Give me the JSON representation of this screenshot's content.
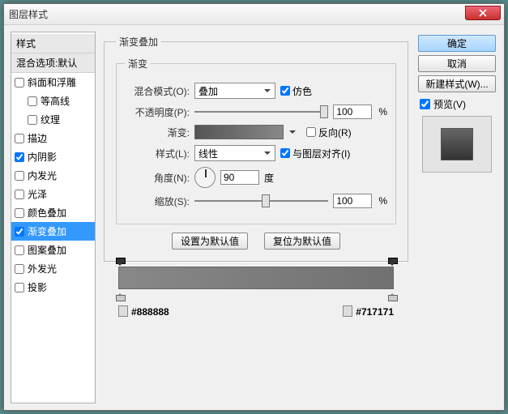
{
  "title": "图层样式",
  "sidebar": {
    "header": "样式",
    "blend_defaults": "混合选项:默认",
    "items": [
      {
        "label": "斜面和浮雕",
        "checked": false
      },
      {
        "label": "等高线",
        "checked": false,
        "sub": true
      },
      {
        "label": "纹理",
        "checked": false,
        "sub": true
      },
      {
        "label": "描边",
        "checked": false
      },
      {
        "label": "内阴影",
        "checked": true
      },
      {
        "label": "内发光",
        "checked": false
      },
      {
        "label": "光泽",
        "checked": false
      },
      {
        "label": "颜色叠加",
        "checked": false
      },
      {
        "label": "渐变叠加",
        "checked": true,
        "active": true
      },
      {
        "label": "图案叠加",
        "checked": false
      },
      {
        "label": "外发光",
        "checked": false
      },
      {
        "label": "投影",
        "checked": false
      }
    ]
  },
  "panel": {
    "title": "渐变叠加",
    "sub": "渐变",
    "blend_label": "混合模式(O):",
    "blend_value": "叠加",
    "dither_label": "仿色",
    "opacity_label": "不透明度(P):",
    "opacity_value": "100",
    "pct": "%",
    "gradient_label": "渐变:",
    "reverse_label": "反向(R)",
    "style_label": "样式(L):",
    "style_value": "线性",
    "align_label": "与图层对齐(I)",
    "angle_label": "角度(N):",
    "angle_value": "90",
    "deg": "度",
    "scale_label": "缩放(S):",
    "scale_value": "100",
    "btn_default": "设置为默认值",
    "btn_reset": "复位为默认值",
    "hex_left": "#888888",
    "hex_right": "#717171"
  },
  "right": {
    "ok": "确定",
    "cancel": "取消",
    "newstyle": "新建样式(W)...",
    "preview_label": "预览(V)"
  }
}
